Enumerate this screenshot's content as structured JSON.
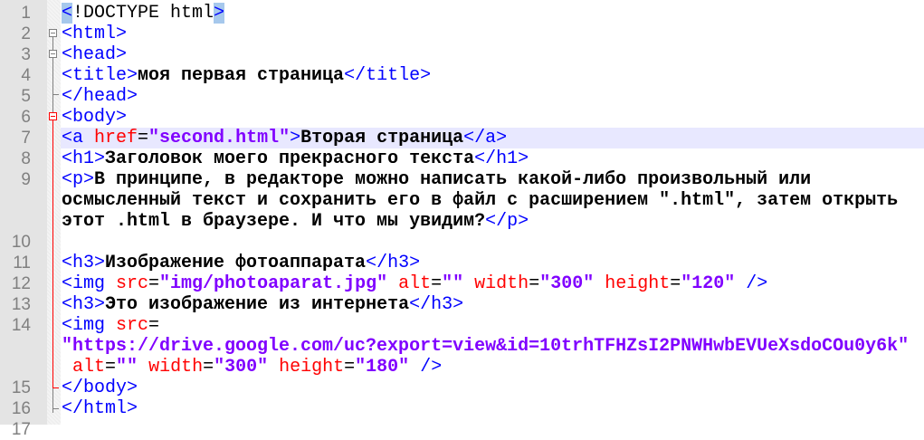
{
  "editor": {
    "current_line": 7,
    "colors": {
      "tag": "#0000ff",
      "attribute": "#ff0000",
      "value": "#8000ff",
      "text": "#000000",
      "current_line_bg": "#e8e8ff",
      "brace_match_bg": "#a6c8ec"
    },
    "rows": [
      {
        "n": "1",
        "seg": [
          [
            "brace",
            "<"
          ],
          [
            "plain",
            "!DOCTYPE html"
          ],
          [
            "brace",
            ">"
          ]
        ]
      },
      {
        "n": "2",
        "seg": [
          [
            "tag",
            "<html>"
          ]
        ]
      },
      {
        "n": "3",
        "seg": [
          [
            "tag",
            "<head>"
          ]
        ]
      },
      {
        "n": "4",
        "seg": [
          [
            "tag",
            "<title>"
          ],
          [
            "txt",
            "моя первая страница"
          ],
          [
            "tag",
            "</title>"
          ]
        ]
      },
      {
        "n": "5",
        "seg": [
          [
            "tag",
            "</head>"
          ]
        ]
      },
      {
        "n": "6",
        "seg": [
          [
            "tag",
            "<body>"
          ]
        ]
      },
      {
        "n": "7",
        "seg": [
          [
            "tag",
            "<a "
          ],
          [
            "attr",
            "href"
          ],
          [
            "plain",
            "="
          ],
          [
            "val",
            "\"second.html\""
          ],
          [
            "tag",
            ">"
          ],
          [
            "txt",
            "Вторая страница"
          ],
          [
            "tag",
            "</a>"
          ]
        ]
      },
      {
        "n": "8",
        "seg": [
          [
            "tag",
            "<h1>"
          ],
          [
            "txt",
            "Заголовок моего прекрасного текста"
          ],
          [
            "tag",
            "</h1>"
          ]
        ]
      },
      {
        "n": "9",
        "seg": [
          [
            "tag",
            "<p>"
          ],
          [
            "txt",
            "В принципе, в редакторе можно написать какой-либо произвольный или"
          ]
        ]
      },
      {
        "n": "",
        "seg": [
          [
            "txt",
            "осмысленный текст и сохранить его в файл с расширением \".html\", затем открыть"
          ]
        ]
      },
      {
        "n": "",
        "seg": [
          [
            "txt",
            "этот .html в браузере. И что мы увидим?"
          ],
          [
            "tag",
            "</p>"
          ]
        ]
      },
      {
        "n": "10",
        "seg": []
      },
      {
        "n": "11",
        "seg": [
          [
            "tag",
            "<h3>"
          ],
          [
            "txt",
            "Изображение фотоаппарата"
          ],
          [
            "tag",
            "</h3>"
          ]
        ]
      },
      {
        "n": "12",
        "seg": [
          [
            "tag",
            "<img "
          ],
          [
            "attr",
            "src"
          ],
          [
            "plain",
            "="
          ],
          [
            "val",
            "\"img/photoaparat.jpg\""
          ],
          [
            "plain",
            " "
          ],
          [
            "attr",
            "alt"
          ],
          [
            "plain",
            "="
          ],
          [
            "val",
            "\"\""
          ],
          [
            "plain",
            " "
          ],
          [
            "attr",
            "width"
          ],
          [
            "plain",
            "="
          ],
          [
            "val",
            "\"300\""
          ],
          [
            "plain",
            " "
          ],
          [
            "attr",
            "height"
          ],
          [
            "plain",
            "="
          ],
          [
            "val",
            "\"120\""
          ],
          [
            "plain",
            " "
          ],
          [
            "tag",
            "/>"
          ]
        ]
      },
      {
        "n": "13",
        "seg": [
          [
            "tag",
            "<h3>"
          ],
          [
            "txt",
            "Это изображение из интернета"
          ],
          [
            "tag",
            "</h3>"
          ]
        ]
      },
      {
        "n": "14",
        "seg": [
          [
            "tag",
            "<img "
          ],
          [
            "attr",
            "src"
          ],
          [
            "plain",
            "="
          ]
        ]
      },
      {
        "n": "",
        "seg": [
          [
            "val",
            "\"https://drive.google.com/uc?export=view&id=10trhTFHZsI2PNWHwbEVUeXsdoCOu0y6k\""
          ]
        ]
      },
      {
        "n": "",
        "seg": [
          [
            "plain",
            " "
          ],
          [
            "attr",
            "alt"
          ],
          [
            "plain",
            "="
          ],
          [
            "val",
            "\"\""
          ],
          [
            "plain",
            " "
          ],
          [
            "attr",
            "width"
          ],
          [
            "plain",
            "="
          ],
          [
            "val",
            "\"300\""
          ],
          [
            "plain",
            " "
          ],
          [
            "attr",
            "height"
          ],
          [
            "plain",
            "="
          ],
          [
            "val",
            "\"180\""
          ],
          [
            "plain",
            " "
          ],
          [
            "tag",
            "/>"
          ]
        ]
      },
      {
        "n": "15",
        "seg": [
          [
            "tag",
            "</body>"
          ]
        ]
      },
      {
        "n": "16",
        "seg": [
          [
            "tag",
            "</html>"
          ]
        ]
      },
      {
        "n": "17",
        "seg": []
      }
    ]
  }
}
